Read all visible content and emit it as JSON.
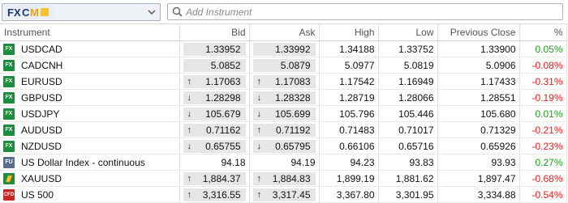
{
  "search": {
    "placeholder": "Add Instrument"
  },
  "columns": [
    "Instrument",
    "Bid",
    "Ask",
    "High",
    "Low",
    "Previous Close",
    "%"
  ],
  "colors": {
    "positive": "#1e9f1e",
    "negative": "#e01e1e",
    "fx_badge": "#1e8c3c"
  },
  "rows": [
    {
      "icon": "fx-badge",
      "badge": "FX",
      "name": "USDCAD",
      "bid": "1.33952",
      "ask": "1.33992",
      "dir": "",
      "high": "1.34188",
      "low": "1.33752",
      "prev": "1.33900",
      "pct": "0.05%",
      "sign": "pos"
    },
    {
      "icon": "fx-badge",
      "badge": "FX",
      "name": "CADCNH",
      "bid": "5.0852",
      "ask": "5.0879",
      "dir": "",
      "high": "5.0977",
      "low": "5.0819",
      "prev": "5.0906",
      "pct": "-0.08%",
      "sign": "neg"
    },
    {
      "icon": "fx-badge",
      "badge": "FX",
      "name": "EURUSD",
      "bid": "1.17063",
      "ask": "1.17083",
      "dir": "up",
      "high": "1.17542",
      "low": "1.16949",
      "prev": "1.17433",
      "pct": "-0.31%",
      "sign": "neg"
    },
    {
      "icon": "fx-badge",
      "badge": "FX",
      "name": "GBPUSD",
      "bid": "1.28298",
      "ask": "1.28328",
      "dir": "down",
      "high": "1.28719",
      "low": "1.28066",
      "prev": "1.28551",
      "pct": "-0.19%",
      "sign": "neg"
    },
    {
      "icon": "fx-badge",
      "badge": "FX",
      "name": "USDJPY",
      "bid": "105.679",
      "ask": "105.699",
      "dir": "down",
      "high": "105.796",
      "low": "105.446",
      "prev": "105.680",
      "pct": "0.01%",
      "sign": "pos"
    },
    {
      "icon": "fx-badge",
      "badge": "FX",
      "name": "AUDUSD",
      "bid": "0.71162",
      "ask": "0.71192",
      "dir": "up",
      "high": "0.71483",
      "low": "0.71017",
      "prev": "0.71329",
      "pct": "-0.21%",
      "sign": "neg"
    },
    {
      "icon": "fx-badge",
      "badge": "FX",
      "name": "NZDUSD",
      "bid": "0.65755",
      "ask": "0.65795",
      "dir": "down",
      "high": "0.66106",
      "low": "0.65716",
      "prev": "0.65926",
      "pct": "-0.23%",
      "sign": "neg"
    },
    {
      "icon": "fu-badge",
      "badge": "FU",
      "name": "US Dollar Index - continuous",
      "bid": "94.18",
      "ask": "94.19",
      "dir": "none",
      "high": "94.23",
      "low": "93.83",
      "prev": "93.93",
      "pct": "0.27%",
      "sign": "pos"
    },
    {
      "icon": "gold-bar-icon",
      "badge": "",
      "name": "XAUUSD",
      "bid": "1,884.37",
      "ask": "1,884.83",
      "dir": "up",
      "high": "1,899.19",
      "low": "1,881.62",
      "prev": "1,897.47",
      "pct": "-0.68%",
      "sign": "neg"
    },
    {
      "icon": "cfd-badge",
      "badge": "CFD",
      "name": "US 500",
      "bid": "3,316.55",
      "ask": "3,317.45",
      "dir": "up",
      "high": "3,367.80",
      "low": "3,301.95",
      "prev": "3,334.88",
      "pct": "-0.54%",
      "sign": "neg"
    }
  ]
}
